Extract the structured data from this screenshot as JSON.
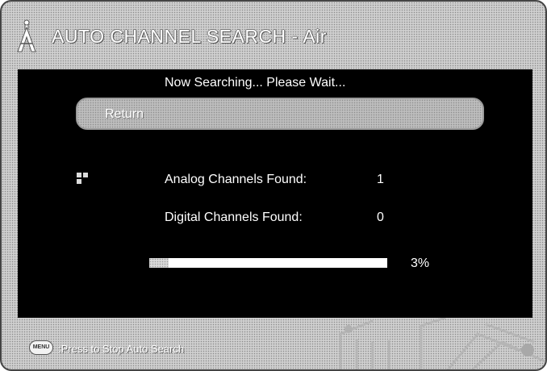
{
  "header": {
    "title": "AUTO CHANNEL SEARCH - Air",
    "icon": "antenna-icon"
  },
  "search": {
    "status": "Now Searching... Please Wait...",
    "return_label": "Return",
    "analog_label": "Analog Channels Found:",
    "analog_count": "1",
    "digital_label": "Digital Channels Found:",
    "digital_count": "0",
    "progress_label": "3%",
    "progress_value": 0.08
  },
  "footer": {
    "menu_key_label": "MENU",
    "hint": ":Press to Stop Auto Search"
  },
  "colors": {
    "panel": "#000000",
    "text": "#ffffff",
    "frame": "#cfcfcf"
  }
}
